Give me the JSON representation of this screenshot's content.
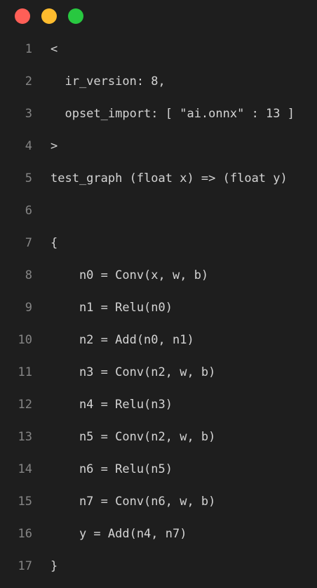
{
  "window": {
    "controls": [
      {
        "name": "close",
        "color": "#ff5f57"
      },
      {
        "name": "minimize",
        "color": "#febc2e"
      },
      {
        "name": "maximize",
        "color": "#28c840"
      }
    ]
  },
  "code": {
    "lines": [
      {
        "number": "1",
        "text": "<"
      },
      {
        "number": "2",
        "text": "  ir_version: 8,"
      },
      {
        "number": "3",
        "text": "  opset_import: [ \"ai.onnx\" : 13 ]"
      },
      {
        "number": "4",
        "text": ">"
      },
      {
        "number": "5",
        "text": "test_graph (float x) => (float y)"
      },
      {
        "number": "6",
        "text": ""
      },
      {
        "number": "7",
        "text": "{"
      },
      {
        "number": "8",
        "text": "    n0 = Conv(x, w, b)"
      },
      {
        "number": "9",
        "text": "    n1 = Relu(n0)"
      },
      {
        "number": "10",
        "text": "    n2 = Add(n0, n1)"
      },
      {
        "number": "11",
        "text": "    n3 = Conv(n2, w, b)"
      },
      {
        "number": "12",
        "text": "    n4 = Relu(n3)"
      },
      {
        "number": "13",
        "text": "    n5 = Conv(n2, w, b)"
      },
      {
        "number": "14",
        "text": "    n6 = Relu(n5)"
      },
      {
        "number": "15",
        "text": "    n7 = Conv(n6, w, b)"
      },
      {
        "number": "16",
        "text": "    y = Add(n4, n7)"
      },
      {
        "number": "17",
        "text": "}"
      }
    ]
  }
}
